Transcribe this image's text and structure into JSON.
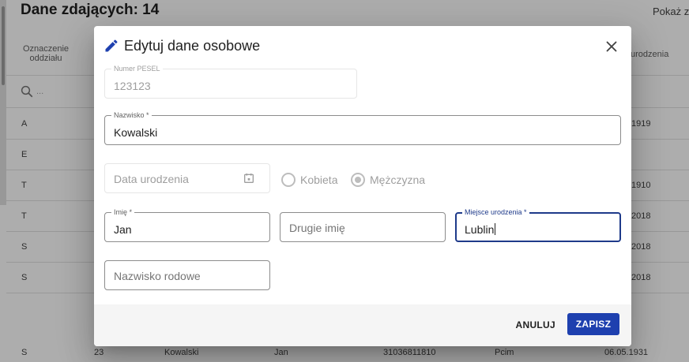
{
  "background": {
    "title": "Dane zdających: 14",
    "show_label": "Pokaż z",
    "header": {
      "col_branch": "Oznaczenie oddziału",
      "col_birthdate": "urodzenia"
    },
    "filter_placeholder": "...",
    "rows": [
      {
        "branch": "A",
        "date": "1919"
      },
      {
        "branch": "E",
        "date": ""
      },
      {
        "branch": "T",
        "date": "1910"
      },
      {
        "branch": "T",
        "date": "2018"
      },
      {
        "branch": "S",
        "date": "2018"
      },
      {
        "branch": "S",
        "date": "2018"
      },
      {
        "branch": "S",
        "number": "23",
        "surname": "Kowalski",
        "name": "Jan",
        "pesel": "31036811810",
        "place": "Pcim",
        "date": "06.05.1931"
      }
    ]
  },
  "dialog": {
    "title": "Edytuj dane osobowe",
    "pesel": {
      "label": "Numer PESEL",
      "value": "123123"
    },
    "surname": {
      "label": "Nazwisko *",
      "value": "Kowalski"
    },
    "birth_date": {
      "placeholder": "Data urodzenia"
    },
    "gender": {
      "female": "Kobieta",
      "male": "Mężczyzna",
      "selected": "male"
    },
    "first_name": {
      "label": "Imię *",
      "value": "Jan"
    },
    "second_name": {
      "placeholder": "Drugie imię"
    },
    "birth_place": {
      "label": "Miejsce urodzenia *",
      "value": "Lublin"
    },
    "maiden_name": {
      "placeholder": "Nazwisko rodowe"
    },
    "cancel_label": "ANULUJ",
    "save_label": "ZAPISZ"
  },
  "colors": {
    "accent": "#1e40af",
    "focus": "#1e3a8a",
    "overlay": "rgba(0,0,0,0.32)"
  }
}
